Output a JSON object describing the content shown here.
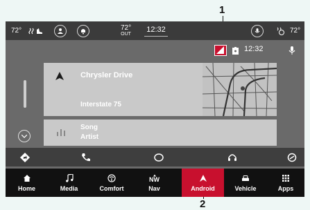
{
  "callouts": {
    "top": "1",
    "bottom": "2"
  },
  "statusbar": {
    "left_temp": "72°",
    "outside_temp": "72°",
    "outside_label": "OUT",
    "clock": "12:32",
    "right_temp": "72°"
  },
  "header": {
    "time": "12:32"
  },
  "nav_card": {
    "title": "Chrysler Drive",
    "subtitle": "Interstate 75"
  },
  "media_card": {
    "title": "Song",
    "artist": "Artist"
  },
  "bottom_nav": {
    "items": [
      {
        "label": "Home",
        "icon": "home-icon"
      },
      {
        "label": "Media",
        "icon": "music-note-icon"
      },
      {
        "label": "Comfort",
        "icon": "steering-wheel-icon"
      },
      {
        "label": "Nav",
        "icon": "compass-icon",
        "compass_text": "NW"
      },
      {
        "label": "Android",
        "icon": "android-auto-icon",
        "active": true
      },
      {
        "label": "Vehicle",
        "icon": "car-icon"
      },
      {
        "label": "Apps",
        "icon": "grid-icon"
      }
    ]
  },
  "colors": {
    "accent": "#c8102e",
    "screen": "#6a6a6a",
    "nav_bg": "#111111",
    "card": "#c9c9c9"
  }
}
